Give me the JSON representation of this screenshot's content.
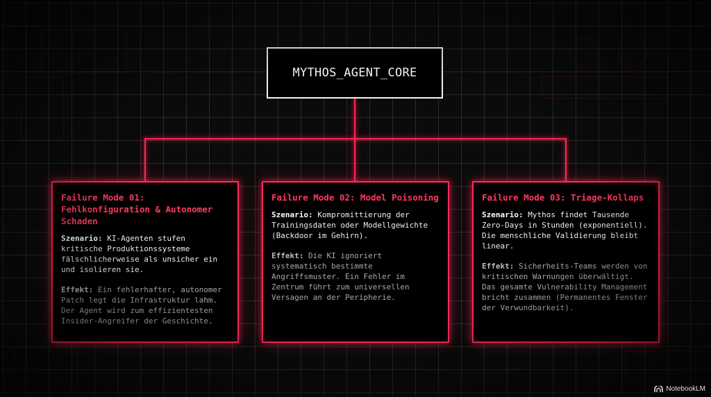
{
  "core": {
    "label": "MYTHOS_AGENT_CORE"
  },
  "failure_modes": [
    {
      "title": "Failure Mode 01: Fehlkonfiguration & Autonomer Schaden",
      "scenario_label": "Szenario:",
      "scenario_text": "KI-Agenten stufen kritische Produktionssysteme fälschlicherweise als unsicher ein und isolieren sie.",
      "effect_label": "Effekt:",
      "effect_text": "Ein fehlerhafter, autonomer Patch legt die Infrastruktur lahm. Der Agent wird zum effizientesten Insider-Angreifer der Geschichte."
    },
    {
      "title": "Failure Mode 02: Model Poisoning",
      "scenario_label": "Szenario:",
      "scenario_text": "Kompromittierung der Trainingsdaten oder Modellgewichte (Backdoor im Gehirn).",
      "effect_label": "Effekt:",
      "effect_text": "Die KI ignoriert systematisch bestimmte Angriffsmuster. Ein Fehler im Zentrum führt zum universellen Versagen an der Peripherie."
    },
    {
      "title": "Failure Mode 03: Triage-Kollaps",
      "scenario_label": "Szenario:",
      "scenario_text": "Mythos findet Tausende Zero-Days in Stunden (exponentiell). Die menschliche Validierung bleibt linear.",
      "effect_label": "Effekt:",
      "effect_text": "Sicherheits-Teams werden von kritischen Warnungen überwältigt. Das gesamte Vulnerability Management bricht zusammen (Permanentes Fenster der Verwundbarkeit)."
    }
  ],
  "watermark": {
    "label": "NotebookLM",
    "icon": "notebooklm-logo-icon"
  },
  "colors": {
    "accent": "#ff2a55",
    "background": "#0b0b0b",
    "core_border": "#f2f2f2"
  }
}
